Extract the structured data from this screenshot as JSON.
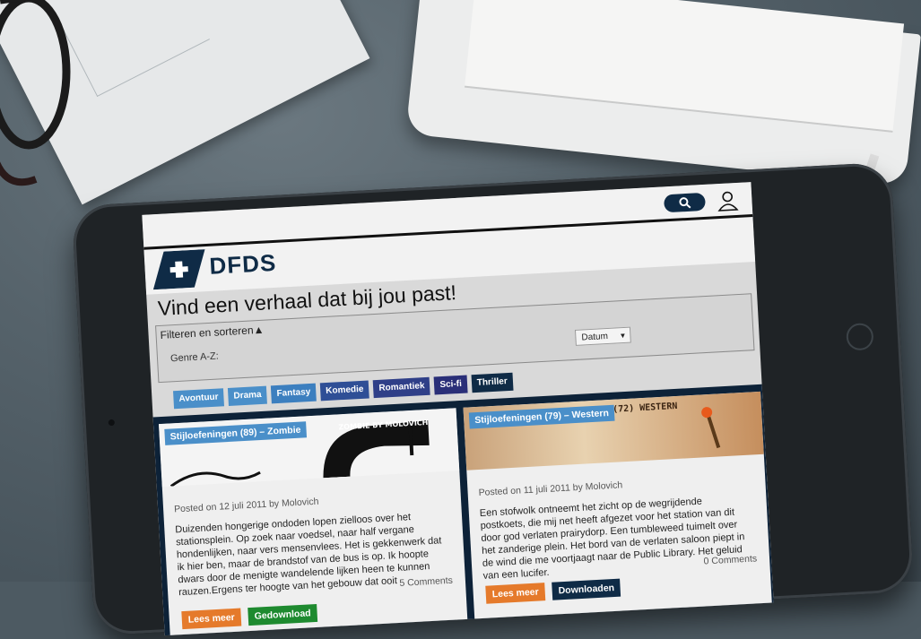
{
  "header": {
    "brand": "DFDS"
  },
  "page": {
    "title": "Vind een verhaal dat bij jou past!"
  },
  "filters": {
    "title": "Filteren en sorteren▲",
    "genre_label": "Genre A-Z:",
    "sort_value": "Datum",
    "genres": [
      {
        "label": "Avontuur",
        "color": "#4a8fc9"
      },
      {
        "label": "Drama",
        "color": "#4a8fc9"
      },
      {
        "label": "Fantasy",
        "color": "#3c7fbf"
      },
      {
        "label": "Komedie",
        "color": "#2f4f96"
      },
      {
        "label": "Romantiek",
        "color": "#2f3f88"
      },
      {
        "label": "Sci-fi",
        "color": "#2a2f78"
      },
      {
        "label": "Thriller",
        "color": "#0f2b46"
      }
    ]
  },
  "posts": [
    {
      "tag": "Stijloefeningen (89) – Zombie",
      "meta": "Posted on 12 juli 2011 by Molovich",
      "excerpt": "Duizenden hongerige ondoden lopen zielloos over het stationsplein. Op zoek naar voedsel, naar half vergane hondenlijken, naar vers mensenvlees. Het is gekkenwerk dat ik hier ben, maar de brandstof van de bus is op. Ik hoopte dwars door de menigte wandelende lijken heen te kunnen rauzen.Ergens ter hoogte van het gebouw dat ooit",
      "comments": "5 Comments",
      "read_more": "Lees meer",
      "action": "Gedownload",
      "image_text": "ZOMBIE BY MOLOVICH"
    },
    {
      "tag": "Stijloefeningen (79) – Western",
      "meta": "Posted on 11 juli 2011 by Molovich",
      "excerpt": "Een stofwolk ontneemt het zicht op de wegrijdende postkoets, die mij net heeft afgezet voor het station van dit door god verlaten prairydorp. Een tumbleweed tuimelt over het zanderige plein. Het bord van de verlaten saloon piept in de wind die me voortjaagt naar de Public Library. Het geluid van een lucifer.",
      "comments": "0 Comments",
      "read_more": "Lees meer",
      "action": "Downloaden",
      "image_text": "STIJLOEFENINGEN (72) WESTERN"
    }
  ]
}
